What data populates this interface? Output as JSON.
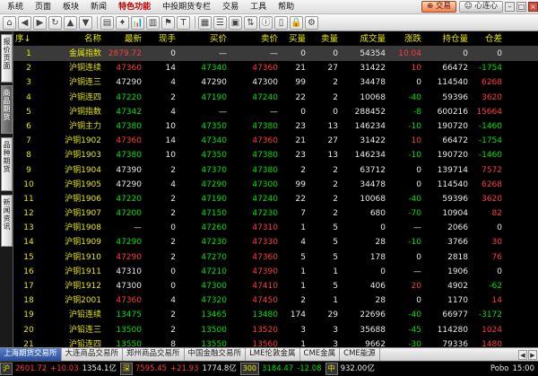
{
  "menu": {
    "items": [
      "系统",
      "页面",
      "板块",
      "新闻",
      "特色功能",
      "中投期货专栏",
      "交易",
      "工具",
      "帮助"
    ],
    "active_index": 4,
    "trade_label": "交易",
    "connect_label": "心连心"
  },
  "toolbar": {
    "icons": [
      "home-icon",
      "back-icon",
      "forward-icon",
      "refresh-icon",
      "up-icon",
      "down-icon",
      "chart-icon",
      "kline-icon",
      "f10-icon",
      "news-icon",
      "alert-icon",
      "filter-icon",
      "grid-icon",
      "list-icon",
      "select-icon",
      "scroll-icon",
      "info-icon",
      "bar-icon",
      "lock-icon",
      "settings-icon"
    ],
    "glyphs": [
      "⌂",
      "◀",
      "▶",
      "↻",
      "▲",
      "▼",
      "▤",
      "✦",
      "📊",
      "▥",
      "⚑",
      "T",
      "▦",
      "☰",
      "▣",
      "⇅",
      "ⓘ",
      "▯",
      "🔒",
      "⚙"
    ]
  },
  "side_tabs": [
    "报价页面",
    "商品期货",
    "品种期货",
    "新闻资讯"
  ],
  "table": {
    "headers": [
      "序↓",
      "名称",
      "最新",
      "现手",
      "买价",
      "卖价",
      "买量",
      "卖量",
      "成交量",
      "涨跌",
      "持仓量",
      "仓差"
    ],
    "rows": [
      {
        "idx": "1",
        "name": "金属指数",
        "last": "2879.72",
        "vol": "0",
        "bid": "—",
        "ask": "—",
        "bidv": "0",
        "askv": "0",
        "total": "54354",
        "chg": "10.04",
        "oi": "0",
        "oid": "0",
        "c": [
          "y",
          "r",
          "w",
          "w",
          "w",
          "w",
          "w",
          "w",
          "r",
          "w",
          "w"
        ],
        "sel": true
      },
      {
        "idx": "2",
        "name": "沪铜连续",
        "last": "47360",
        "vol": "14",
        "bid": "47340",
        "ask": "47360",
        "bidv": "21",
        "askv": "27",
        "total": "31422",
        "chg": "10",
        "oi": "66472",
        "oid": "-1754",
        "c": [
          "y",
          "r",
          "w",
          "g",
          "r",
          "w",
          "w",
          "w",
          "r",
          "w",
          "g"
        ]
      },
      {
        "idx": "3",
        "name": "沪铜连三",
        "last": "47290",
        "vol": "4",
        "bid": "47290",
        "ask": "47300",
        "bidv": "99",
        "askv": "2",
        "total": "34478",
        "chg": "0",
        "oi": "114540",
        "oid": "6268",
        "c": [
          "y",
          "w",
          "w",
          "w",
          "w",
          "w",
          "w",
          "w",
          "w",
          "w",
          "r"
        ]
      },
      {
        "idx": "4",
        "name": "沪铜连四",
        "last": "47220",
        "vol": "2",
        "bid": "47190",
        "ask": "47240",
        "bidv": "22",
        "askv": "2",
        "total": "10068",
        "chg": "-40",
        "oi": "59396",
        "oid": "3620",
        "c": [
          "y",
          "g",
          "w",
          "g",
          "g",
          "w",
          "w",
          "w",
          "g",
          "w",
          "r"
        ]
      },
      {
        "idx": "5",
        "name": "沪铜指数",
        "last": "47342",
        "vol": "4",
        "bid": "—",
        "ask": "—",
        "bidv": "0",
        "askv": "0",
        "total": "288452",
        "chg": "-8",
        "oi": "600216",
        "oid": "15664",
        "c": [
          "y",
          "g",
          "w",
          "w",
          "w",
          "w",
          "w",
          "w",
          "g",
          "w",
          "r"
        ]
      },
      {
        "idx": "6",
        "name": "沪铜主力",
        "last": "47380",
        "vol": "10",
        "bid": "47350",
        "ask": "47380",
        "bidv": "23",
        "askv": "13",
        "total": "146234",
        "chg": "-10",
        "oi": "190720",
        "oid": "-1460",
        "c": [
          "y",
          "g",
          "w",
          "g",
          "g",
          "w",
          "w",
          "w",
          "g",
          "w",
          "g"
        ]
      },
      {
        "idx": "7",
        "name": "沪铜1902",
        "last": "47360",
        "vol": "14",
        "bid": "47340",
        "ask": "47360",
        "bidv": "21",
        "askv": "27",
        "total": "31422",
        "chg": "10",
        "oi": "66472",
        "oid": "-1754",
        "c": [
          "y",
          "r",
          "w",
          "g",
          "r",
          "w",
          "w",
          "w",
          "r",
          "w",
          "g"
        ]
      },
      {
        "idx": "8",
        "name": "沪铜1903",
        "last": "47380",
        "vol": "10",
        "bid": "47350",
        "ask": "47380",
        "bidv": "23",
        "askv": "13",
        "total": "146234",
        "chg": "-10",
        "oi": "190720",
        "oid": "-1460",
        "c": [
          "y",
          "g",
          "w",
          "g",
          "g",
          "w",
          "w",
          "w",
          "g",
          "w",
          "g"
        ]
      },
      {
        "idx": "9",
        "name": "沪铜1904",
        "last": "47390",
        "vol": "2",
        "bid": "47370",
        "ask": "47380",
        "bidv": "2",
        "askv": "2",
        "total": "63712",
        "chg": "0",
        "oi": "139714",
        "oid": "7572",
        "c": [
          "y",
          "w",
          "w",
          "g",
          "g",
          "w",
          "w",
          "w",
          "w",
          "w",
          "r"
        ]
      },
      {
        "idx": "10",
        "name": "沪铜1905",
        "last": "47290",
        "vol": "4",
        "bid": "47290",
        "ask": "47300",
        "bidv": "99",
        "askv": "2",
        "total": "34478",
        "chg": "0",
        "oi": "114540",
        "oid": "6268",
        "c": [
          "y",
          "w",
          "w",
          "g",
          "g",
          "w",
          "w",
          "w",
          "w",
          "w",
          "r"
        ]
      },
      {
        "idx": "11",
        "name": "沪铜1906",
        "last": "47220",
        "vol": "2",
        "bid": "47190",
        "ask": "47240",
        "bidv": "22",
        "askv": "2",
        "total": "10068",
        "chg": "-40",
        "oi": "59396",
        "oid": "3620",
        "c": [
          "y",
          "g",
          "w",
          "g",
          "g",
          "w",
          "w",
          "w",
          "g",
          "w",
          "r"
        ]
      },
      {
        "idx": "12",
        "name": "沪铜1907",
        "last": "47200",
        "vol": "2",
        "bid": "47150",
        "ask": "47230",
        "bidv": "7",
        "askv": "2",
        "total": "680",
        "chg": "-70",
        "oi": "10904",
        "oid": "82",
        "c": [
          "y",
          "g",
          "w",
          "g",
          "g",
          "w",
          "w",
          "w",
          "g",
          "w",
          "r"
        ]
      },
      {
        "idx": "13",
        "name": "沪铜1908",
        "last": "—",
        "vol": "0",
        "bid": "47260",
        "ask": "47310",
        "bidv": "1",
        "askv": "5",
        "total": "0",
        "chg": "—",
        "oi": "2066",
        "oid": "0",
        "c": [
          "y",
          "w",
          "w",
          "g",
          "r",
          "w",
          "w",
          "w",
          "w",
          "w",
          "w"
        ]
      },
      {
        "idx": "14",
        "name": "沪铜1909",
        "last": "47290",
        "vol": "2",
        "bid": "47230",
        "ask": "47330",
        "bidv": "4",
        "askv": "5",
        "total": "28",
        "chg": "-10",
        "oi": "3766",
        "oid": "30",
        "c": [
          "y",
          "g",
          "w",
          "g",
          "r",
          "w",
          "w",
          "w",
          "g",
          "w",
          "r"
        ]
      },
      {
        "idx": "15",
        "name": "沪铜1910",
        "last": "47290",
        "vol": "2",
        "bid": "47270",
        "ask": "47360",
        "bidv": "5",
        "askv": "5",
        "total": "178",
        "chg": "0",
        "oi": "2818",
        "oid": "76",
        "c": [
          "y",
          "r",
          "w",
          "g",
          "r",
          "w",
          "w",
          "w",
          "w",
          "w",
          "r"
        ]
      },
      {
        "idx": "16",
        "name": "沪铜1911",
        "last": "47310",
        "vol": "0",
        "bid": "47210",
        "ask": "47390",
        "bidv": "1",
        "askv": "1",
        "total": "0",
        "chg": "—",
        "oi": "1906",
        "oid": "0",
        "c": [
          "y",
          "w",
          "w",
          "g",
          "r",
          "w",
          "w",
          "w",
          "w",
          "w",
          "w"
        ]
      },
      {
        "idx": "17",
        "name": "沪铜1912",
        "last": "47300",
        "vol": "0",
        "bid": "47300",
        "ask": "47410",
        "bidv": "1",
        "askv": "5",
        "total": "406",
        "chg": "20",
        "oi": "4902",
        "oid": "-62",
        "c": [
          "y",
          "w",
          "w",
          "g",
          "r",
          "w",
          "w",
          "w",
          "r",
          "w",
          "g"
        ]
      },
      {
        "idx": "18",
        "name": "沪铜2001",
        "last": "47360",
        "vol": "4",
        "bid": "47320",
        "ask": "47450",
        "bidv": "2",
        "askv": "1",
        "total": "28",
        "chg": "0",
        "oi": "1170",
        "oid": "14",
        "c": [
          "y",
          "r",
          "w",
          "g",
          "r",
          "w",
          "w",
          "w",
          "w",
          "w",
          "r"
        ]
      },
      {
        "idx": "19",
        "name": "沪铅连续",
        "last": "13475",
        "vol": "2",
        "bid": "13465",
        "ask": "13480",
        "bidv": "174",
        "askv": "29",
        "total": "22696",
        "chg": "-40",
        "oi": "66977",
        "oid": "-3172",
        "c": [
          "y",
          "g",
          "w",
          "g",
          "g",
          "w",
          "w",
          "w",
          "g",
          "w",
          "g"
        ]
      },
      {
        "idx": "20",
        "name": "沪铅连三",
        "last": "13500",
        "vol": "2",
        "bid": "13500",
        "ask": "13520",
        "bidv": "3",
        "askv": "3",
        "total": "35688",
        "chg": "-45",
        "oi": "114280",
        "oid": "1024",
        "c": [
          "y",
          "g",
          "w",
          "g",
          "r",
          "w",
          "w",
          "w",
          "g",
          "w",
          "r"
        ]
      },
      {
        "idx": "21",
        "name": "沪铅连四",
        "last": "13550",
        "vol": "8",
        "bid": "13550",
        "ask": "13560",
        "bidv": "1",
        "askv": "3",
        "total": "9662",
        "chg": "-30",
        "oi": "79336",
        "oid": "1480",
        "c": [
          "y",
          "g",
          "w",
          "g",
          "r",
          "w",
          "w",
          "w",
          "g",
          "w",
          "r"
        ]
      }
    ]
  },
  "exchange_tabs": [
    "上海期货交易所",
    "大连商品交易所",
    "郑州商品交易所",
    "中国金融交易所",
    "LME伦敦金属",
    "CME金属",
    "CME能源"
  ],
  "exchange_active": 0,
  "status": {
    "prefix": "沪",
    "p1": "2601.72",
    "c1": "+10.03",
    "a1": "1354.1亿",
    "n2": "深",
    "p2": "7595.45",
    "c2": "+21.93",
    "a2": "1774.8亿",
    "p3": "300",
    "p4": "3184.47",
    "c4": "-12.08",
    "n5": "中",
    "p5": "932.00亿",
    "tail1": "Pobo",
    "tail2": "15:00"
  }
}
